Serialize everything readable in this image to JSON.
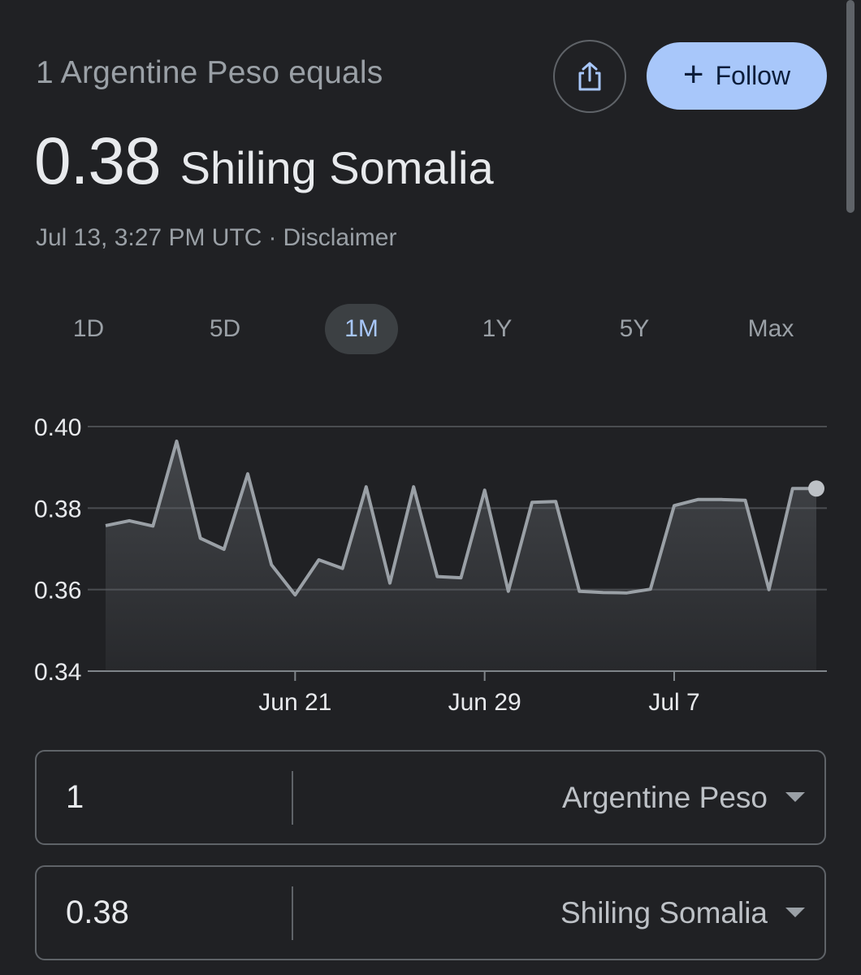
{
  "header": {
    "subtitle": "1 Argentine Peso equals",
    "rate_value": "0.38",
    "rate_currency": "Shiling Somalia",
    "timestamp": "Jul 13, 3:27 PM UTC",
    "separator": "·",
    "disclaimer": "Disclaimer"
  },
  "actions": {
    "share_icon": "share-icon",
    "follow_label": "Follow",
    "follow_icon": "+"
  },
  "ranges": {
    "tabs": [
      "1D",
      "5D",
      "1M",
      "1Y",
      "5Y",
      "Max"
    ],
    "active": "1M"
  },
  "colors": {
    "background": "#202124",
    "accent": "#a8c7fa",
    "line": "#9aa0a6"
  },
  "chart_data": {
    "type": "area",
    "title": "",
    "xlabel": "",
    "ylabel": "",
    "ylim": [
      0.34,
      0.4
    ],
    "ytick_labels": [
      "0.40",
      "0.38",
      "0.36",
      "0.34"
    ],
    "yticks": [
      0.4,
      0.38,
      0.36,
      0.34
    ],
    "xtick_labels": [
      "Jun 21",
      "Jun 29",
      "Jul 7"
    ],
    "xticks": [
      "2023-06-21",
      "2023-06-29",
      "2023-07-07"
    ],
    "grid": true,
    "series": [
      {
        "x": [
          "2023-06-13",
          "2023-06-14",
          "2023-06-15",
          "2023-06-16",
          "2023-06-17",
          "2023-06-18",
          "2023-06-19",
          "2023-06-20",
          "2023-06-21",
          "2023-06-22",
          "2023-06-23",
          "2023-06-24",
          "2023-06-25",
          "2023-06-26",
          "2023-06-27",
          "2023-06-28",
          "2023-06-29",
          "2023-06-30",
          "2023-07-01",
          "2023-07-02",
          "2023-07-03",
          "2023-07-04",
          "2023-07-05",
          "2023-07-06",
          "2023-07-07",
          "2023-07-08",
          "2023-07-09",
          "2023-07-10",
          "2023-07-11",
          "2023-07-12",
          "2023-07-13"
        ],
        "values": [
          0.3757,
          0.3769,
          0.3756,
          0.3964,
          0.3726,
          0.3699,
          0.3884,
          0.3661,
          0.3587,
          0.3673,
          0.3652,
          0.3852,
          0.3616,
          0.3852,
          0.3632,
          0.3629,
          0.3844,
          0.3596,
          0.3814,
          0.3816,
          0.3596,
          0.3593,
          0.3592,
          0.3601,
          0.3806,
          0.3821,
          0.3821,
          0.3819,
          0.36,
          0.3848,
          0.3848
        ]
      }
    ]
  },
  "converter": {
    "from_amount": "1",
    "from_currency": "Argentine Peso",
    "to_amount": "0.38",
    "to_currency": "Shiling Somalia"
  }
}
